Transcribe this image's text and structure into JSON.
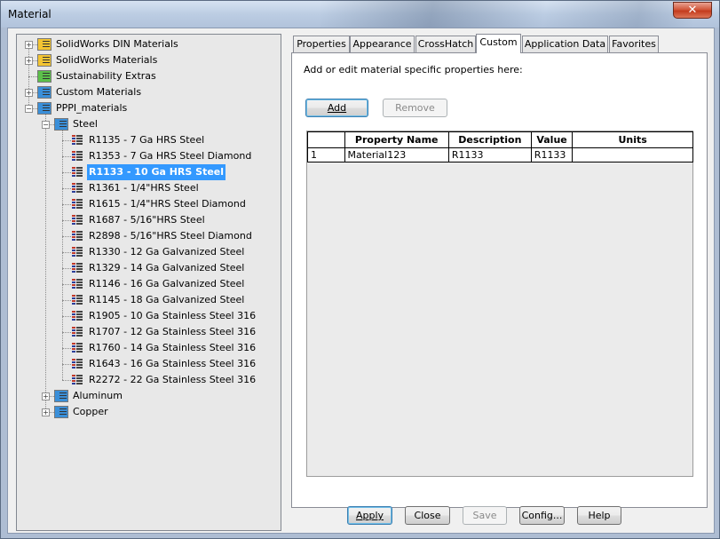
{
  "window": {
    "title": "Material",
    "close_glyph": "✕"
  },
  "tree": {
    "top_nodes": [
      {
        "label": "SolidWorks DIN Materials",
        "expander": "+"
      },
      {
        "label": "SolidWorks Materials",
        "expander": "+"
      },
      {
        "label": "Sustainability Extras",
        "expander": ""
      },
      {
        "label": "Custom Materials",
        "expander": "+"
      },
      {
        "label": "PPPI_materials",
        "expander": "−"
      }
    ],
    "categories": [
      {
        "label": "Steel",
        "expander": "−"
      },
      {
        "label": "Aluminum",
        "expander": "+"
      },
      {
        "label": "Copper",
        "expander": "+"
      }
    ],
    "steel_items": [
      "R1135 - 7 Ga HRS Steel",
      "R1353 - 7 Ga HRS Steel Diamond",
      "R1133 - 10 Ga HRS Steel",
      "R1361 - 1/4\"HRS Steel",
      "R1615 - 1/4\"HRS Steel Diamond",
      "R1687 - 5/16\"HRS Steel",
      "R2898 - 5/16\"HRS Steel Diamond",
      "R1330 - 12 Ga Galvanized Steel",
      "R1329 - 14 Ga Galvanized Steel",
      "R1146 - 16 Ga Galvanized Steel",
      "R1145 - 18 Ga Galvanized Steel",
      "R1905 - 10 Ga Stainless Steel 316",
      "R1707 - 12 Ga Stainless Steel 316",
      "R1760 - 14 Ga Stainless Steel 316",
      "R1643 - 16 Ga Stainless Steel 316",
      "R2272 - 22 Ga Stainless Steel 316"
    ],
    "selected_item": "R1133 - 10 Ga HRS Steel"
  },
  "tabs": {
    "items": [
      "Properties",
      "Appearance",
      "CrossHatch",
      "Custom",
      "Application Data",
      "Favorites"
    ],
    "active": "Custom"
  },
  "custom": {
    "instructions": "Add or edit material specific properties here:",
    "add_label": "Add",
    "remove_label": "Remove",
    "table": {
      "columns": [
        "",
        "Property Name",
        "Description",
        "Value",
        "Units"
      ],
      "rows": [
        [
          "1",
          "Material123",
          "R1133",
          "R1133",
          ""
        ]
      ]
    }
  },
  "footer": {
    "apply_label": "Apply",
    "close_label": "Close",
    "save_label": "Save",
    "config_label": "Config...",
    "help_label": "Help"
  },
  "colors": {
    "selection": "#3399ff",
    "tree_background": "#e8e8e8",
    "folder_yellow": "#f3c432",
    "folder_green": "#5cc04a",
    "folder_blue": "#3a8fd9"
  }
}
